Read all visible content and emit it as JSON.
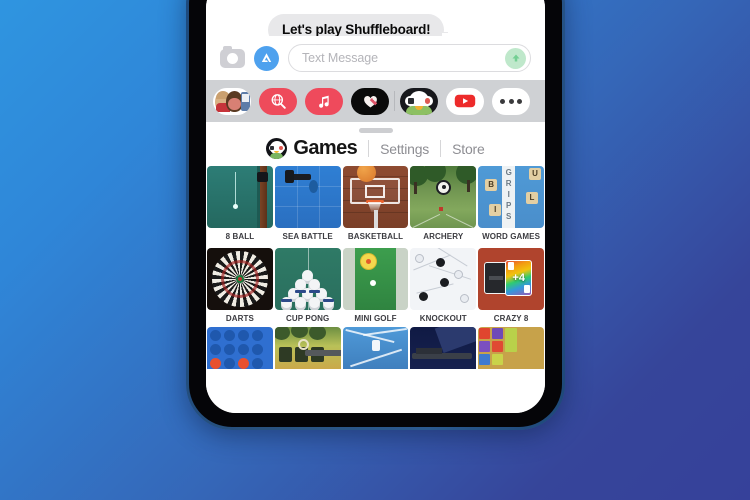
{
  "background": {
    "gradient_from": "#2f95e0",
    "gradient_to": "#36419a"
  },
  "device": {
    "frame_color": "#27527f",
    "bezel_color": "#050508",
    "screen_bg": "#ffffff"
  },
  "conversation": {
    "messages": [
      {
        "sender": "them",
        "text": "Let's play Shuffleboard!"
      }
    ]
  },
  "input_bar": {
    "camera_icon": "camera-icon",
    "appstore_icon": "app-store-icon",
    "placeholder": "Text Message",
    "value": "",
    "send_icon": "send-arrow-icon",
    "send_color": "#bfe8cb"
  },
  "app_drawer": {
    "icons": [
      {
        "name": "memoji-stickers",
        "label": "Memoji"
      },
      {
        "name": "app-store-search",
        "label": "#images"
      },
      {
        "name": "apple-music",
        "label": "Music"
      },
      {
        "name": "fitness-activity",
        "label": "Fitness"
      },
      {
        "name": "game-center",
        "label": "Game Pigeon",
        "selected": true
      },
      {
        "name": "youtube",
        "label": "YouTube"
      },
      {
        "name": "more",
        "label": "More"
      }
    ]
  },
  "games_panel": {
    "grabber": true,
    "logo_icon": "game-pigeon-logo",
    "title": "Games",
    "links": [
      {
        "label": "Settings"
      },
      {
        "label": "Store"
      }
    ],
    "grid": [
      [
        {
          "label": "8 BALL",
          "art": "8ball"
        },
        {
          "label": "SEA BATTLE",
          "art": "sea"
        },
        {
          "label": "BASKETBALL",
          "art": "bball"
        },
        {
          "label": "ARCHERY",
          "art": "arch"
        },
        {
          "label": "WORD GAMES",
          "art": "word"
        }
      ],
      [
        {
          "label": "DARTS",
          "art": "darts"
        },
        {
          "label": "CUP PONG",
          "art": "cup"
        },
        {
          "label": "MINI GOLF",
          "art": "golf"
        },
        {
          "label": "KNOCKOUT",
          "art": "knock"
        },
        {
          "label": "CRAZY 8",
          "art": "crazy"
        }
      ]
    ],
    "word_tiles": {
      "left": [
        "B",
        "I"
      ],
      "right": [
        "U",
        "L"
      ],
      "vertical": [
        "G",
        "R",
        "I",
        "P",
        "S"
      ]
    },
    "crazy8_card_value": "+4",
    "partial_row": [
      {
        "art": "connect"
      },
      {
        "art": "tank"
      },
      {
        "art": "laser"
      },
      {
        "art": "night"
      },
      {
        "art": "blocks"
      }
    ]
  }
}
